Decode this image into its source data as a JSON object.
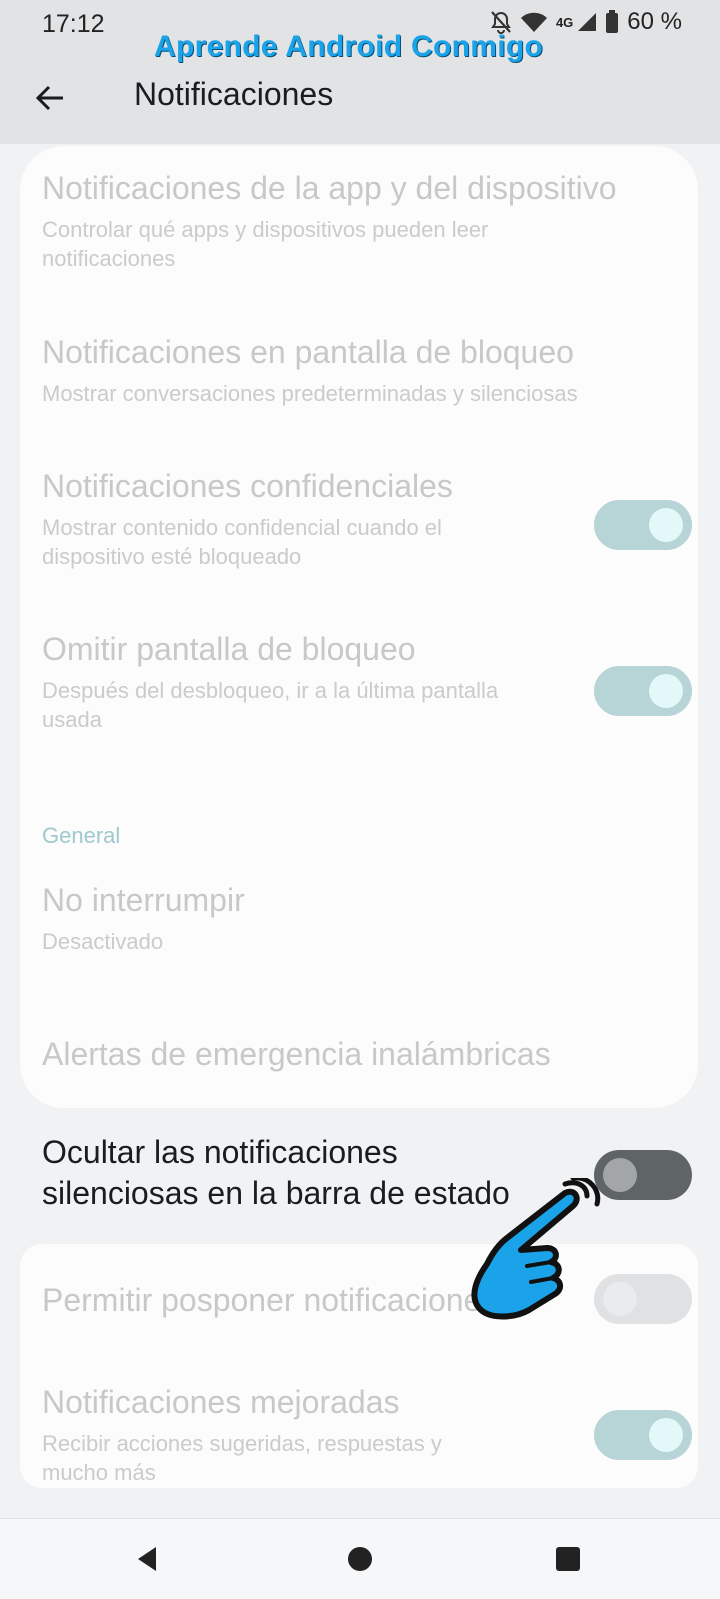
{
  "status_bar": {
    "time": "17:12",
    "network": "4G",
    "battery": "60 %",
    "icons": [
      "bell-off-icon",
      "wifi-icon",
      "signal-icon",
      "battery-icon"
    ]
  },
  "watermark": "Aprende Android Conmigo",
  "header": {
    "title": "Notificaciones",
    "back_icon": "arrow-left-icon"
  },
  "settings": {
    "app_device": {
      "title": "Notificaciones de la app y del dispositivo",
      "subtitle": "Controlar qué apps y dispositivos pueden leer notificaciones"
    },
    "lock_screen": {
      "title": "Notificaciones en pantalla de bloqueo",
      "subtitle": "Mostrar conversaciones predeterminadas y silenciosas"
    },
    "confidential": {
      "title": "Notificaciones confidenciales",
      "subtitle": "Mostrar contenido confidencial cuando el dispositivo esté bloqueado",
      "enabled": true
    },
    "skip_lock": {
      "title": "Omitir pantalla de bloqueo",
      "subtitle": "Después del desbloqueo, ir a la última pantalla usada",
      "enabled": true
    },
    "section_general": "General",
    "dnd": {
      "title": "No interrumpir",
      "subtitle": "Desactivado"
    },
    "emergency": {
      "title": "Alertas de emergencia inalámbricas"
    },
    "hide_silent": {
      "title_line1": "Ocultar las notificaciones",
      "title_line2": "silenciosas en la barra de estado",
      "enabled": false
    },
    "snooze": {
      "title": "Permitir posponer notificaciones",
      "enabled": false
    },
    "enhanced": {
      "title": "Notificaciones mejoradas",
      "subtitle": "Recibir acciones sugeridas, respuestas y mucho más",
      "enabled": true
    }
  },
  "colors": {
    "accent": "#1aa3e8",
    "toggle_on_track": "#b7d4d6",
    "toggle_off_track": "#5f6567"
  },
  "navbar": {
    "icons": [
      "nav-back-icon",
      "nav-home-icon",
      "nav-recents-icon"
    ]
  }
}
